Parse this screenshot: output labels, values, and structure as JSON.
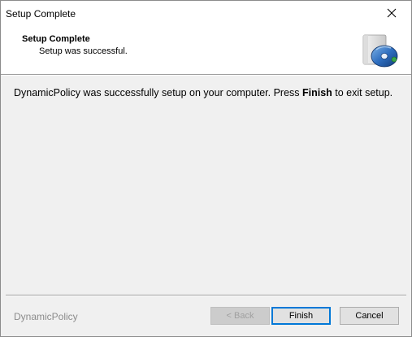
{
  "window": {
    "title": "Setup Complete",
    "close_icon": "close-icon"
  },
  "header": {
    "title": "Setup Complete",
    "subtitle": "Setup was successful.",
    "icon": "setup-package-icon"
  },
  "body": {
    "message_part1": "DynamicPolicy was successfully setup on your computer.  Press ",
    "message_bold": "Finish",
    "message_part2": " to exit setup."
  },
  "footer": {
    "brand": "DynamicPolicy",
    "back_label": "< Back",
    "finish_label": "Finish",
    "cancel_label": "Cancel"
  },
  "colors": {
    "dialog_bg": "#f0f0f0",
    "header_bg": "#ffffff",
    "default_button_border": "#0078d7",
    "disabled_text": "#a0a0a0"
  }
}
